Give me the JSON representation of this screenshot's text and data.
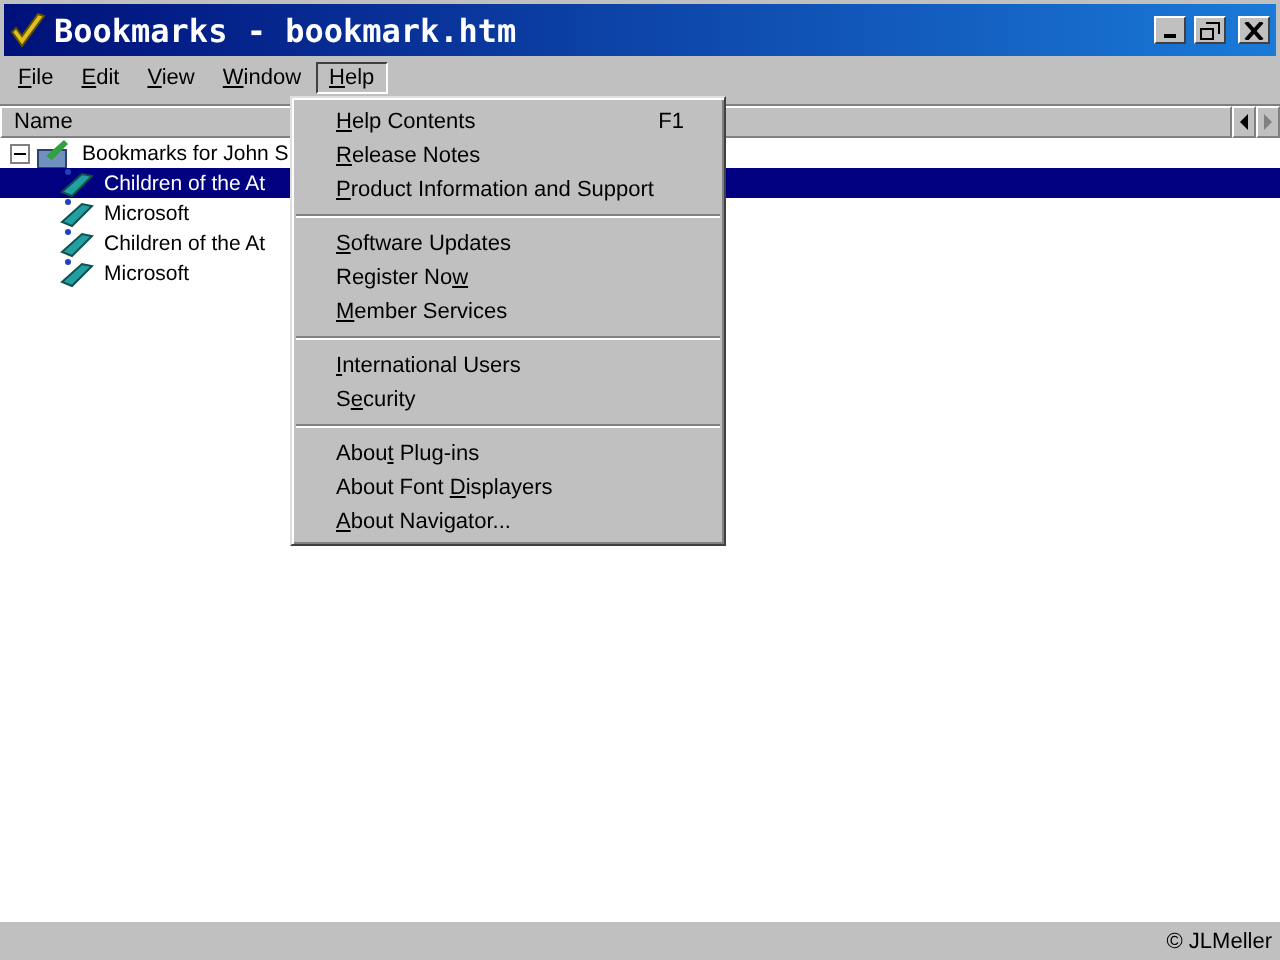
{
  "window": {
    "title": "Bookmarks - bookmark.htm"
  },
  "menu_bar": [
    {
      "key": "F",
      "after": "ile",
      "selected": false
    },
    {
      "key": "E",
      "after": "dit",
      "selected": false
    },
    {
      "key": "V",
      "after": "iew",
      "selected": false
    },
    {
      "key": "W",
      "after": "indow",
      "selected": false
    },
    {
      "key": "H",
      "after": "elp",
      "selected": true
    }
  ],
  "list": {
    "columns": [
      "Name"
    ],
    "tree": [
      {
        "label": "Bookmarks for John S",
        "expanded": true,
        "kind": "folder",
        "selected": false,
        "children": [
          {
            "label": "Children of the At",
            "kind": "bookmark",
            "selected": true
          },
          {
            "label": "Microsoft",
            "kind": "bookmark",
            "selected": false
          },
          {
            "label": "Children of the At",
            "kind": "bookmark",
            "selected": false
          },
          {
            "label": "Microsoft",
            "kind": "bookmark",
            "selected": false
          }
        ]
      }
    ]
  },
  "help_menu": {
    "groups": [
      [
        {
          "key": "H",
          "after": "elp Contents",
          "shortcut": "F1"
        },
        {
          "key": "R",
          "after": "elease Notes"
        },
        {
          "key": "P",
          "after": "roduct Information and Support"
        }
      ],
      [
        {
          "key": "S",
          "after": "oftware Updates"
        },
        {
          "before": "Register No",
          "key": "w"
        },
        {
          "key": "M",
          "after": "ember Services"
        }
      ],
      [
        {
          "key": "I",
          "after": "nternational Users"
        },
        {
          "before": "S",
          "key": "e",
          "after": "curity"
        }
      ],
      [
        {
          "before": "Abou",
          "key": "t",
          "after": " Plug-ins"
        },
        {
          "before": "About Font ",
          "key": "D",
          "after": "isplayers"
        },
        {
          "key": "A",
          "after": "bout Navigator..."
        }
      ]
    ]
  },
  "status_bar": {
    "text": "© JLMeller"
  }
}
